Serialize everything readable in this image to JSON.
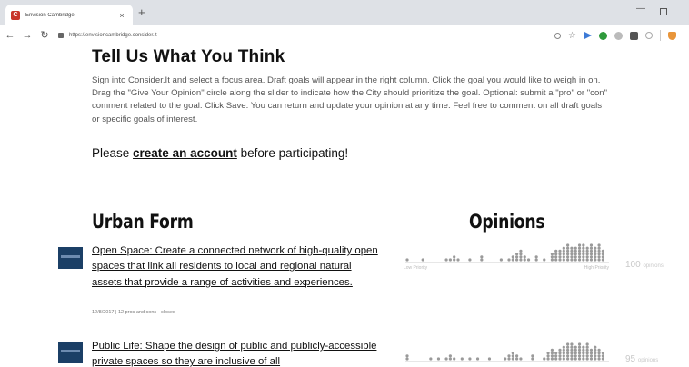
{
  "browser": {
    "tab_title": "Envision Cambridge",
    "tab_close": "×",
    "new_tab": "+",
    "url": "https://envisioncambridge.consider.it"
  },
  "page": {
    "heading": "Tell Us What You Think",
    "intro": "Sign into Consider.It and select a focus area. Draft goals will appear in the right column. Click the goal you would like to weigh in on. Drag the \"Give Your Opinion\" circle along the slider to indicate how the City should prioritize the goal. Optional: submit a \"pro\" or \"con\" comment related to the goal. Click Save. You can return and update your opinion at any time. Feel free to comment on all draft goals or specific goals of interest.",
    "please_prefix": "Please ",
    "create_account_link": "create an account",
    "please_suffix": " before participating!"
  },
  "section": {
    "title": "Urban Form",
    "opinions_title": "Opinions"
  },
  "goals": [
    {
      "title": "Open Space: Create a connected network of high-quality open spaces that link all residents to local and regional natural assets that provide a range of activities and experiences.",
      "meta": "12/8/2017  |  12 pros and cons  ·  closed",
      "opinion_count": "100",
      "opinion_unit": "opinions",
      "low_label": "Low Priority",
      "high_label": "High Priority"
    },
    {
      "title": "Public Life: Shape the design of public and publicly-accessible private spaces so they are inclusive of all",
      "opinion_count": "95",
      "opinion_unit": "opinions"
    }
  ],
  "colors": {
    "dot": "#9a9a9a",
    "thumb": "#1b3f66"
  }
}
